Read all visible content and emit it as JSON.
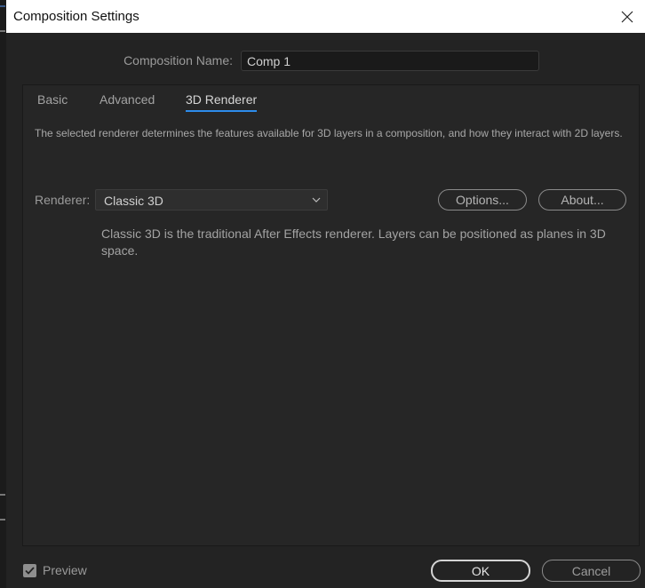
{
  "window": {
    "title": "Composition Settings"
  },
  "composition": {
    "name_label": "Composition Name:",
    "name_value": "Comp 1"
  },
  "tabs": [
    {
      "label": "Basic",
      "active": false
    },
    {
      "label": "Advanced",
      "active": false
    },
    {
      "label": "3D Renderer",
      "active": true
    }
  ],
  "renderer_tab": {
    "description": "The selected renderer determines the features available for 3D layers in a composition, and how they interact with 2D layers.",
    "renderer_label": "Renderer:",
    "renderer_selected": "Classic 3D",
    "options_button": "Options...",
    "about_button": "About...",
    "renderer_note": "Classic 3D is the traditional After Effects renderer. Layers can be positioned as planes in 3D space."
  },
  "footer": {
    "preview_label": "Preview",
    "preview_checked": true,
    "ok_button": "OK",
    "cancel_button": "Cancel"
  },
  "colors": {
    "background": "#232323",
    "titlebar": "#ffffff",
    "accent": "#2d8ceb"
  },
  "icons": {
    "close": "close-icon",
    "dropdown": "chevron-down-icon",
    "check": "checkmark-icon"
  }
}
